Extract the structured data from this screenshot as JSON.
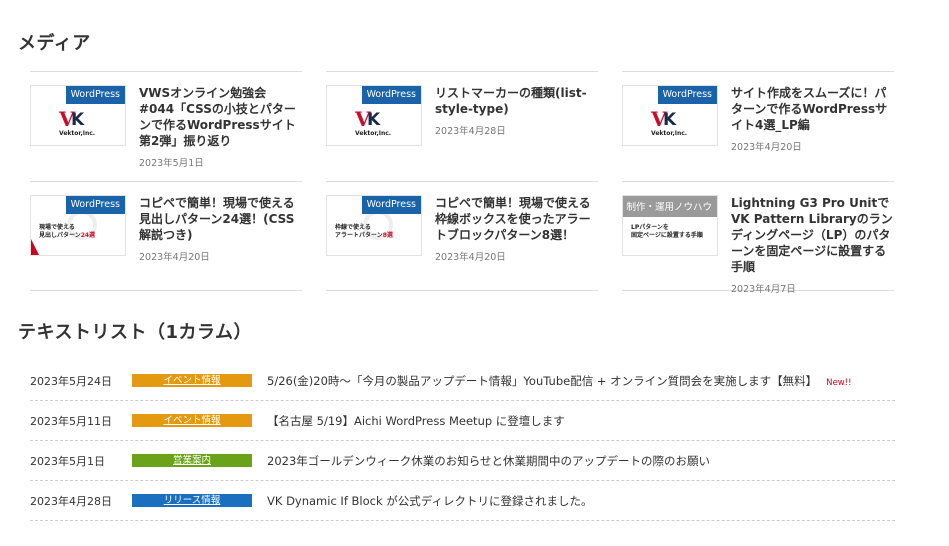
{
  "media": {
    "title": "メディア",
    "cards": [
      {
        "tag": "WordPress",
        "title": "VWSオンライン勉強会 #044「CSSの小技とパターンで作るWordPressサイト第2弾」振り返り",
        "date": "2023年5月1日",
        "thumb": "vektor-logo"
      },
      {
        "tag": "WordPress",
        "title": "リストマーカーの種類(list-style-type)",
        "date": "2023年4月28日",
        "thumb": "vektor-logo"
      },
      {
        "tag": "WordPress",
        "title": "サイト作成をスムーズに！パターンで作るWordPressサイト4選_LP編",
        "date": "2023年4月20日",
        "thumb": "vektor-logo"
      },
      {
        "tag": "WordPress",
        "title": "コピペで簡単！現場で使える見出しパターン24選！(CSS解説つき)",
        "date": "2023年4月20日",
        "thumb": "banner",
        "banner_line1": "現場で使える",
        "banner_line2": "見出しパターン",
        "banner_hl": "24選"
      },
      {
        "tag": "WordPress",
        "title": "コピペで簡単！現場で使える枠線ボックスを使ったアラートブロックパターン8選！",
        "date": "2023年4月20日",
        "thumb": "banner",
        "banner_line1": "枠線で使える",
        "banner_line2": "アラートパターン",
        "banner_hl": "8選"
      },
      {
        "tag": "制作・運用ノウハウ",
        "title": "Lightning G3 Pro UnitでVK Pattern Libraryのランディングページ（LP）のパターンを固定ページに設置する手順",
        "date": "2023年4月7日",
        "thumb": "banner",
        "banner_line1": "LPパターンを",
        "banner_line2": "固定ページに設置する手順",
        "banner_hl": ""
      }
    ],
    "thumb_logo_company": "Vektor,Inc."
  },
  "textlist": {
    "title": "テキストリスト（1カラム）",
    "rows": [
      {
        "date": "2023年5月24日",
        "badge": "イベント情報",
        "badge_color": "#e39a10",
        "title": "5/26(金)20時〜「今月の製品アップデート情報」YouTube配信 + オンライン質問会を実施します【無料】",
        "new": "New!!"
      },
      {
        "date": "2023年5月11日",
        "badge": "イベント情報",
        "badge_color": "#e39a10",
        "title": "【名古屋 5/19】Aichi WordPress Meetup に登壇します",
        "new": ""
      },
      {
        "date": "2023年5月1日",
        "badge": "営業案内",
        "badge_color": "#6aa31a",
        "title": "2023年ゴールデンウィーク休業のお知らせと休業期間中のアップデートの際のお願い",
        "new": ""
      },
      {
        "date": "2023年4月28日",
        "badge": "リリース情報",
        "badge_color": "#1a6fc1",
        "title": "VK Dynamic If Block が公式ディレクトリに登録されました。",
        "new": ""
      }
    ]
  }
}
